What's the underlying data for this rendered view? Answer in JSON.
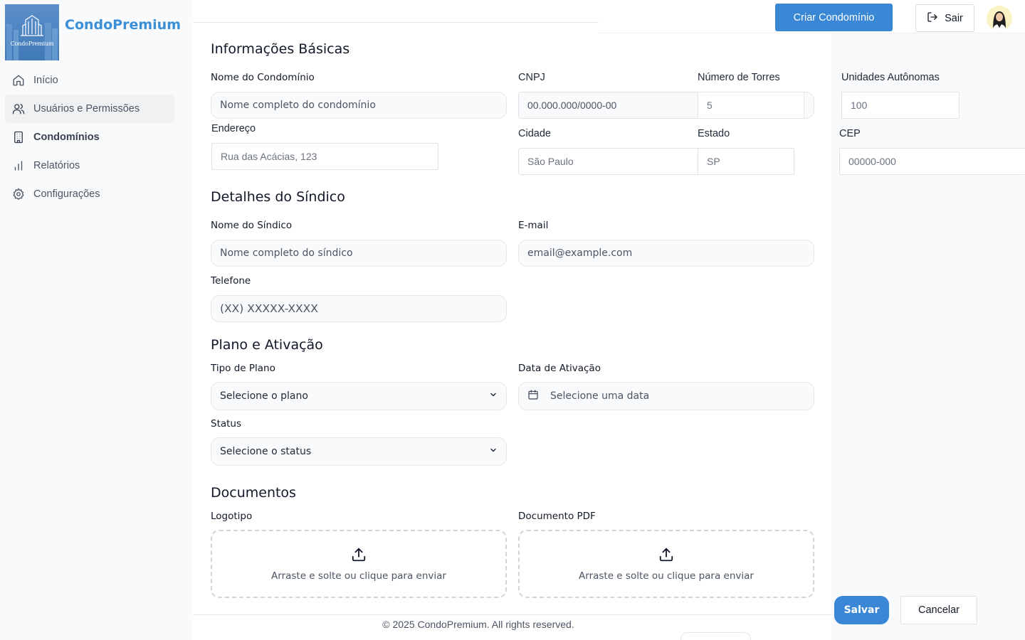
{
  "brand": {
    "name": "CondoPremium",
    "logo_caption": "CondoPremium"
  },
  "sidebar": {
    "items": [
      {
        "label": "Início",
        "icon": "home-icon"
      },
      {
        "label": "Usuários e Permissões",
        "icon": "users-icon",
        "active": true
      },
      {
        "label": "Condomínios",
        "icon": "building-icon",
        "bold": true
      },
      {
        "label": "Relatórios",
        "icon": "bar-chart-icon"
      },
      {
        "label": "Configurações",
        "icon": "gear-icon"
      }
    ]
  },
  "header": {
    "create_button": "Criar Condomínio",
    "logout_button": "Sair"
  },
  "form": {
    "basic": {
      "title": "Informações Básicas",
      "name_label": "Nome do Condomínio",
      "name_placeholder": "Nome completo do condomínio",
      "cnpj_label": "CNPJ",
      "cnpj_placeholder": "00.000.000/0000-00",
      "towers_label": "Número de Torres",
      "towers_value": "5",
      "units_label": "Unidades Autônomas",
      "units_value": "100",
      "address_label": "Endereço",
      "address_placeholder": "Rua das Acácias, 123",
      "city_label": "Cidade",
      "city_placeholder": "São Paulo",
      "state_label": "Estado",
      "state_placeholder": "SP",
      "cep_label": "CEP",
      "cep_placeholder": "00000-000"
    },
    "manager": {
      "title": "Detalhes do Síndico",
      "name_label": "Nome do Síndico",
      "name_placeholder": "Nome completo do síndico",
      "email_label": "E-mail",
      "email_placeholder": "email@example.com",
      "phone_label": "Telefone",
      "phone_placeholder": "(XX) XXXXX-XXXX"
    },
    "plan": {
      "title": "Plano e Ativação",
      "type_label": "Tipo de Plano",
      "type_value": "Selecione o plano",
      "date_label": "Data de Ativação",
      "date_placeholder": "Selecione uma data",
      "status_label": "Status",
      "status_value": "Selecione o status"
    },
    "documents": {
      "title": "Documentos",
      "logo_label": "Logotipo",
      "pdf_label": "Documento PDF",
      "drop_text": "Arraste e solte ou clique para enviar"
    },
    "save_button": "Salvar",
    "cancel_button": "Cancelar"
  },
  "footer": {
    "text": "© 2025 CondoPremium. All rights reserved."
  },
  "colors": {
    "accent": "#3a87d6",
    "brand_text": "#3b8fd6",
    "sidebar_bg": "#f9fafb"
  }
}
